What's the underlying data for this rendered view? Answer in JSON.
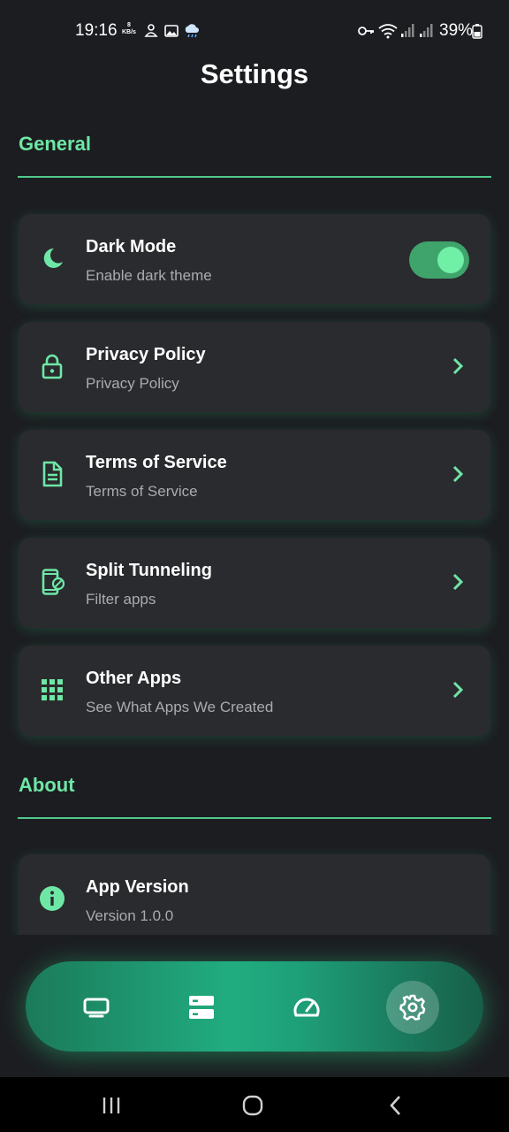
{
  "status_bar": {
    "time": "19:16",
    "speed_value": "8",
    "speed_unit": "KB/s",
    "battery": "39%"
  },
  "page": {
    "title": "Settings"
  },
  "sections": {
    "general": "General",
    "about": "About"
  },
  "settings": {
    "dark_mode": {
      "title": "Dark Mode",
      "subtitle": "Enable dark theme",
      "icon": "moon-icon",
      "enabled": true
    },
    "privacy": {
      "title": "Privacy Policy",
      "subtitle": "Privacy Policy",
      "icon": "lock-icon"
    },
    "terms": {
      "title": "Terms of Service",
      "subtitle": "Terms of Service",
      "icon": "document-icon"
    },
    "split": {
      "title": "Split Tunneling",
      "subtitle": "Filter apps",
      "icon": "phone-filter-icon"
    },
    "other_apps": {
      "title": "Other Apps",
      "subtitle": "See What Apps We Created",
      "icon": "grid-icon"
    },
    "version": {
      "title": "App Version",
      "subtitle": "Version 1.0.0",
      "icon": "info-icon"
    }
  },
  "bottom_nav": {
    "items": [
      {
        "icon": "tv-icon",
        "active": false
      },
      {
        "icon": "servers-icon",
        "active": false
      },
      {
        "icon": "speedometer-icon",
        "active": false
      },
      {
        "icon": "gear-icon",
        "active": true
      }
    ]
  },
  "colors": {
    "accent": "#6ee7a6",
    "background": "#1c1d21",
    "card": "#2a2b2e",
    "nav_gradient_mid": "#21ad80"
  }
}
